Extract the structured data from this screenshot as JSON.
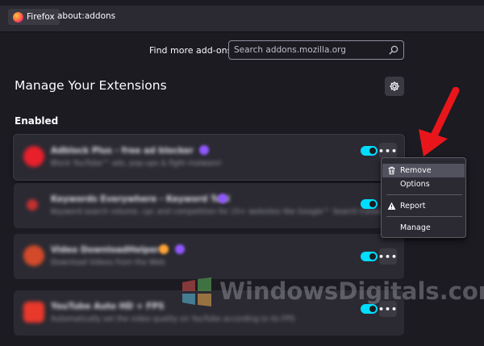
{
  "browser": {
    "identity_label": "Firefox",
    "url": "about:addons"
  },
  "find_more": {
    "label": "Find more add-ons",
    "placeholder": "Search addons.mozilla.org"
  },
  "page": {
    "title": "Manage Your Extensions",
    "section_enabled": "Enabled"
  },
  "extensions": [
    {
      "name": "Adblock Plus - free ad blocker",
      "description": "Block YouTube™ ads, pop-ups & fight malware!",
      "icon_color": "#e8202b",
      "badge_color": "#9059ff",
      "enabled": true,
      "more_label": "•••"
    },
    {
      "name": "Keywords Everywhere - Keyword Tool",
      "description": "Keyword search volume, cpc and competition for 15+ websites like Google™ Search Console",
      "icon_color": "#c43030",
      "badge_color": "#9059ff",
      "enabled": true,
      "more_label": "•••"
    },
    {
      "name": "Video DownloadHelper",
      "description": "Download Videos from the Web",
      "icon_color": "#d24a2a",
      "badge_color": "#ffa436",
      "enabled": true,
      "more_label": "•••"
    },
    {
      "name": "YouTube Auto HD + FPS",
      "description": "Automatically set the video quality on YouTube according to its FPS",
      "icon_color": "#e8392b",
      "badge_color": "#9059ff",
      "enabled": true,
      "more_label": "•••"
    }
  ],
  "context_menu": {
    "remove": "Remove",
    "options": "Options",
    "report": "Report",
    "manage": "Manage"
  },
  "watermark": {
    "text": "WindowsDigitals.com"
  },
  "colors": {
    "accent_toggle": "#00ddff",
    "background": "#1c1b22",
    "card": "#2b2a33",
    "arrow": "#e8161b"
  }
}
